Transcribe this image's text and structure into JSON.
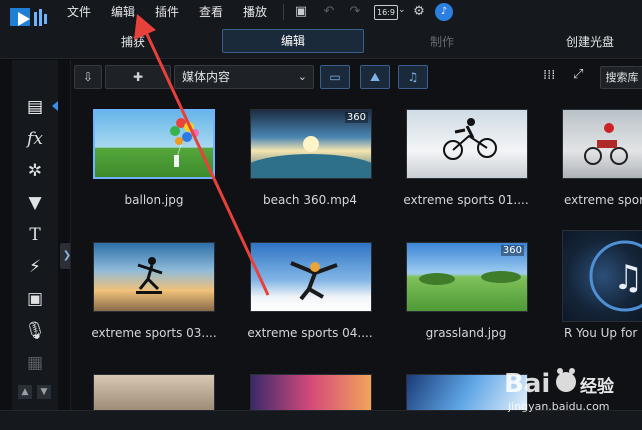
{
  "menu": {
    "items": [
      "文件",
      "编辑",
      "插件",
      "查看",
      "播放"
    ]
  },
  "toolbar": {
    "aspect": "16:9"
  },
  "modes": {
    "capture": "捕获",
    "edit": "编辑",
    "produce": "制作",
    "disc": "创建光盘"
  },
  "library": {
    "dropdown": "媒体内容",
    "search": "搜索库"
  },
  "thumbs": [
    {
      "caption": "ballon.jpg",
      "badge": ""
    },
    {
      "caption": "beach 360.mp4",
      "badge": "360"
    },
    {
      "caption": "extreme sports 01....",
      "badge": ""
    },
    {
      "caption": "extreme sports",
      "badge": ""
    },
    {
      "caption": "extreme sports 03....",
      "badge": ""
    },
    {
      "caption": "extreme sports 04....",
      "badge": ""
    },
    {
      "caption": "grassland.jpg",
      "badge": "360"
    },
    {
      "caption": "R You Up for",
      "badge": ""
    }
  ],
  "watermark": {
    "brand_cn": "经验",
    "url": "jingyan.baidu.com"
  },
  "colors": {
    "accent": "#6fb3ff",
    "arrow": "#e8403a",
    "bg": "#0d0f12"
  }
}
